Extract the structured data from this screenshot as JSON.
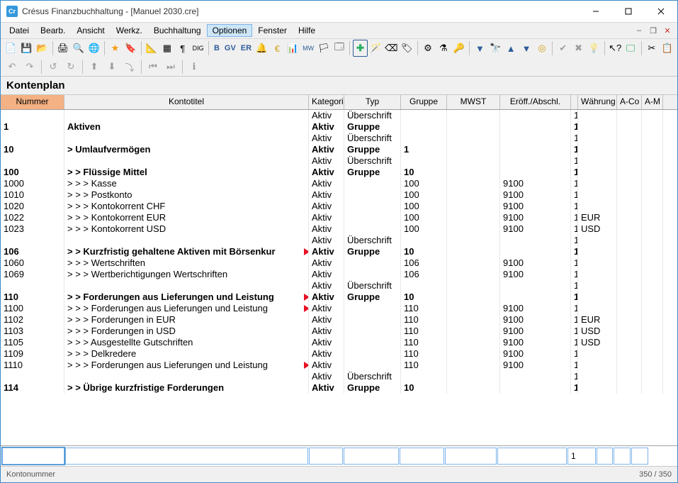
{
  "window": {
    "title": "Crésus Finanzbuchhaltung - [Manuel 2030.cre]",
    "app_abbrev": "Cr"
  },
  "menu": {
    "items": [
      "Datei",
      "Bearb.",
      "Ansicht",
      "Werkz.",
      "Buchhaltung",
      "Optionen",
      "Fenster",
      "Hilfe"
    ],
    "active_index": 5
  },
  "toolbar": {
    "text_buttons": [
      "B",
      "GV",
      "ER"
    ]
  },
  "page": {
    "title": "Kontenplan"
  },
  "grid": {
    "headers": [
      "Nummer",
      "Kontotitel",
      "Kategorie",
      "Typ",
      "Gruppe",
      "MWST",
      "Eröff./Abschl.",
      "Währung",
      "A-Co",
      "A-M"
    ],
    "rows": [
      {
        "b": false,
        "num": "",
        "title": "",
        "cat": "Aktiv",
        "typ": "Überschrift",
        "grp": "",
        "mwst": "",
        "eroff": "",
        "wahr": "1",
        "cur": ""
      },
      {
        "b": true,
        "num": "1",
        "title": "Aktiven",
        "cat": "Aktiv",
        "typ": "Gruppe",
        "grp": "",
        "mwst": "",
        "eroff": "",
        "wahr": "1",
        "cur": ""
      },
      {
        "b": false,
        "num": "",
        "title": "",
        "cat": "Aktiv",
        "typ": "Überschrift",
        "grp": "",
        "mwst": "",
        "eroff": "",
        "wahr": "1",
        "cur": ""
      },
      {
        "b": true,
        "num": "10",
        "title": ">  Umlaufvermögen",
        "cat": "Aktiv",
        "typ": "Gruppe",
        "grp": "1",
        "mwst": "",
        "eroff": "",
        "wahr": "1",
        "cur": ""
      },
      {
        "b": false,
        "num": "",
        "title": "",
        "cat": "Aktiv",
        "typ": "Überschrift",
        "grp": "",
        "mwst": "",
        "eroff": "",
        "wahr": "1",
        "cur": ""
      },
      {
        "b": true,
        "num": "100",
        "title": ">  >  Flüssige Mittel",
        "cat": "Aktiv",
        "typ": "Gruppe",
        "grp": "10",
        "mwst": "",
        "eroff": "",
        "wahr": "1",
        "cur": ""
      },
      {
        "b": false,
        "num": "1000",
        "title": ">  >  >  Kasse",
        "cat": "Aktiv",
        "typ": "",
        "grp": "100",
        "mwst": "",
        "eroff": "9100",
        "wahr": "1",
        "cur": ""
      },
      {
        "b": false,
        "num": "1010",
        "title": ">  >  >  Postkonto",
        "cat": "Aktiv",
        "typ": "",
        "grp": "100",
        "mwst": "",
        "eroff": "9100",
        "wahr": "1",
        "cur": ""
      },
      {
        "b": false,
        "num": "1020",
        "title": ">  >  >  Kontokorrent CHF",
        "cat": "Aktiv",
        "typ": "",
        "grp": "100",
        "mwst": "",
        "eroff": "9100",
        "wahr": "1",
        "cur": ""
      },
      {
        "b": false,
        "num": "1022",
        "title": ">  >  >  Kontokorrent EUR",
        "cat": "Aktiv",
        "typ": "",
        "grp": "100",
        "mwst": "",
        "eroff": "9100",
        "wahr": "1",
        "cur": "EUR"
      },
      {
        "b": false,
        "num": "1023",
        "title": ">  >  >  Kontokorrent USD",
        "cat": "Aktiv",
        "typ": "",
        "grp": "100",
        "mwst": "",
        "eroff": "9100",
        "wahr": "1",
        "cur": "USD"
      },
      {
        "b": false,
        "num": "",
        "title": "",
        "cat": "Aktiv",
        "typ": "Überschrift",
        "grp": "",
        "mwst": "",
        "eroff": "",
        "wahr": "1",
        "cur": ""
      },
      {
        "b": true,
        "num": "106",
        "title": ">  >  Kurzfristig gehaltene Aktiven mit Börsenkur",
        "cat": "Aktiv",
        "typ": "Gruppe",
        "grp": "10",
        "mwst": "",
        "eroff": "",
        "wahr": "1",
        "cur": "",
        "arrow": true
      },
      {
        "b": false,
        "num": "1060",
        "title": ">  >  >  Wertschriften",
        "cat": "Aktiv",
        "typ": "",
        "grp": "106",
        "mwst": "",
        "eroff": "9100",
        "wahr": "1",
        "cur": ""
      },
      {
        "b": false,
        "num": "1069",
        "title": ">  >  >  Wertberichtigungen Wertschriften",
        "cat": "Aktiv",
        "typ": "",
        "grp": "106",
        "mwst": "",
        "eroff": "9100",
        "wahr": "1",
        "cur": ""
      },
      {
        "b": false,
        "num": "",
        "title": "",
        "cat": "Aktiv",
        "typ": "Überschrift",
        "grp": "",
        "mwst": "",
        "eroff": "",
        "wahr": "1",
        "cur": ""
      },
      {
        "b": true,
        "num": "110",
        "title": ">  >  Forderungen aus Lieferungen und Leistung",
        "cat": "Aktiv",
        "typ": "Gruppe",
        "grp": "10",
        "mwst": "",
        "eroff": "",
        "wahr": "1",
        "cur": "",
        "arrow": true
      },
      {
        "b": false,
        "num": "1100",
        "title": ">  >  >  Forderungen aus Lieferungen und Leistung",
        "cat": "Aktiv",
        "typ": "",
        "grp": "110",
        "mwst": "",
        "eroff": "9100",
        "wahr": "1",
        "cur": "",
        "arrow": true
      },
      {
        "b": false,
        "num": "1102",
        "title": ">  >  >  Forderungen in EUR",
        "cat": "Aktiv",
        "typ": "",
        "grp": "110",
        "mwst": "",
        "eroff": "9100",
        "wahr": "1",
        "cur": "EUR"
      },
      {
        "b": false,
        "num": "1103",
        "title": ">  >  >  Forderungen in USD",
        "cat": "Aktiv",
        "typ": "",
        "grp": "110",
        "mwst": "",
        "eroff": "9100",
        "wahr": "1",
        "cur": "USD"
      },
      {
        "b": false,
        "num": "1105",
        "title": ">  >  >  Ausgestellte Gutschriften",
        "cat": "Aktiv",
        "typ": "",
        "grp": "110",
        "mwst": "",
        "eroff": "9100",
        "wahr": "1",
        "cur": "USD"
      },
      {
        "b": false,
        "num": "1109",
        "title": ">  >  >  Delkredere",
        "cat": "Aktiv",
        "typ": "",
        "grp": "110",
        "mwst": "",
        "eroff": "9100",
        "wahr": "1",
        "cur": ""
      },
      {
        "b": false,
        "num": "1110",
        "title": ">  >  >  Forderungen aus Lieferungen und Leistung",
        "cat": "Aktiv",
        "typ": "",
        "grp": "110",
        "mwst": "",
        "eroff": "9100",
        "wahr": "1",
        "cur": "",
        "arrow": true
      },
      {
        "b": false,
        "num": "",
        "title": "",
        "cat": "Aktiv",
        "typ": "Überschrift",
        "grp": "",
        "mwst": "",
        "eroff": "",
        "wahr": "1",
        "cur": ""
      },
      {
        "b": true,
        "num": "114",
        "title": ">  >  Übrige kurzfristige Forderungen",
        "cat": "Aktiv",
        "typ": "Gruppe",
        "grp": "10",
        "mwst": "",
        "eroff": "",
        "wahr": "1",
        "cur": ""
      }
    ]
  },
  "input": {
    "wahr_value": "1"
  },
  "status": {
    "left": "Kontonummer",
    "right": "350 / 350"
  }
}
